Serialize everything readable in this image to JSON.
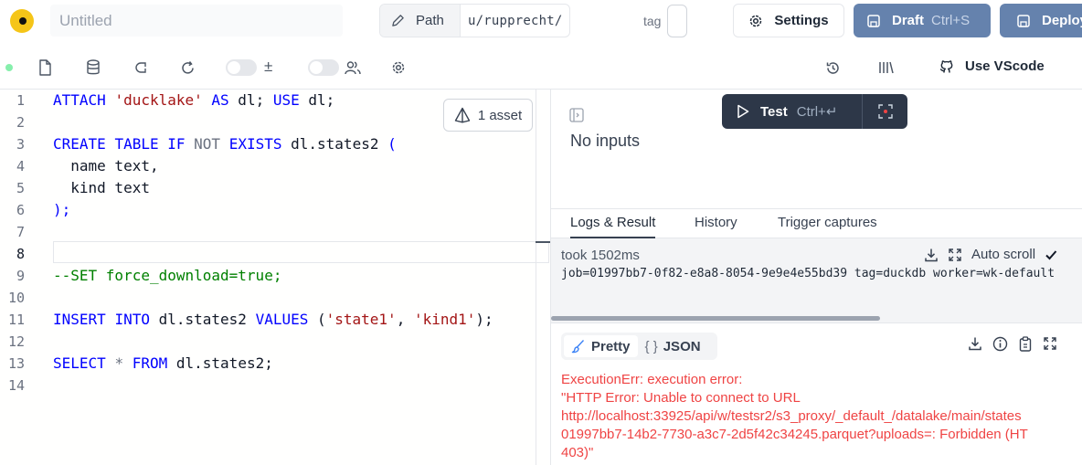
{
  "topbar": {
    "title_placeholder": "Untitled",
    "path_label": "Path",
    "path_value": "u/rupprecht/",
    "tag_label": "tag",
    "settings_label": "Settings",
    "draft_label": "Draft",
    "draft_shortcut": "Ctrl+S",
    "deploy_label": "Deploy"
  },
  "toolbar": {
    "plus_minus": "±",
    "vscode_label": "Use VScode"
  },
  "editor": {
    "asset_label": "1 asset",
    "line_numbers": [
      "1",
      "2",
      "3",
      "4",
      "5",
      "6",
      "7",
      "8",
      "9",
      "10",
      "11",
      "12",
      "13",
      "14"
    ],
    "active_line": "8",
    "lines": [
      [
        {
          "t": "ATTACH",
          "c": "kw"
        },
        {
          "t": " "
        },
        {
          "t": "'ducklake'",
          "c": "str"
        },
        {
          "t": " "
        },
        {
          "t": "AS",
          "c": "kw"
        },
        {
          "t": " dl; "
        },
        {
          "t": "USE",
          "c": "kw"
        },
        {
          "t": " dl;"
        }
      ],
      [],
      [
        {
          "t": "CREATE",
          "c": "kw"
        },
        {
          "t": " "
        },
        {
          "t": "TABLE",
          "c": "kw"
        },
        {
          "t": " "
        },
        {
          "t": "IF",
          "c": "kw"
        },
        {
          "t": " "
        },
        {
          "t": "NOT",
          "c": "op"
        },
        {
          "t": " "
        },
        {
          "t": "EXISTS",
          "c": "kw"
        },
        {
          "t": " dl.states2 "
        },
        {
          "t": "(",
          "c": "kw"
        }
      ],
      [
        {
          "t": "  name text,"
        }
      ],
      [
        {
          "t": "  kind text"
        }
      ],
      [
        {
          "t": ");",
          "c": "kw"
        }
      ],
      [],
      [],
      [
        {
          "t": "--SET force_download=true;",
          "c": "com"
        }
      ],
      [],
      [
        {
          "t": "INSERT",
          "c": "kw"
        },
        {
          "t": " "
        },
        {
          "t": "INTO",
          "c": "kw"
        },
        {
          "t": " dl.states2 "
        },
        {
          "t": "VALUES",
          "c": "kw"
        },
        {
          "t": " ("
        },
        {
          "t": "'state1'",
          "c": "str"
        },
        {
          "t": ", "
        },
        {
          "t": "'kind1'",
          "c": "str"
        },
        {
          "t": ");"
        }
      ],
      [],
      [
        {
          "t": "SELECT",
          "c": "kw"
        },
        {
          "t": " "
        },
        {
          "t": "*",
          "c": "op"
        },
        {
          "t": " "
        },
        {
          "t": "FROM",
          "c": "kw"
        },
        {
          "t": " dl.states2;"
        }
      ],
      []
    ]
  },
  "run": {
    "test_label": "Test",
    "test_shortcut": "Ctrl+↵",
    "no_inputs": "No inputs"
  },
  "tabs": [
    "Logs & Result",
    "History",
    "Trigger captures"
  ],
  "logs": {
    "took": "took 1502ms",
    "auto_scroll": "Auto scroll",
    "job_line": "job=01997bb7-0f82-e8a8-8054-9e9e4e55bd39 tag=duckdb worker=wk-default"
  },
  "result": {
    "pretty_label": "Pretty",
    "json_label": "JSON",
    "json_glyph": "{ }",
    "error_text": "ExecutionErr: execution error:\n\"HTTP Error: Unable to connect to URL\nhttp://localhost:33925/api/w/testsr2/s3_proxy/_default_/datalake/main/states\n01997bb7-14b2-7730-a3c7-2d5f42c34245.parquet?uploads=: Forbidden (HT\n403)\""
  },
  "colors": {
    "accent_button": "#6582ad",
    "test_button": "#2d3748",
    "error": "#ef4444",
    "keyword": "#0000ff",
    "string": "#a31515",
    "comment": "#008000"
  }
}
